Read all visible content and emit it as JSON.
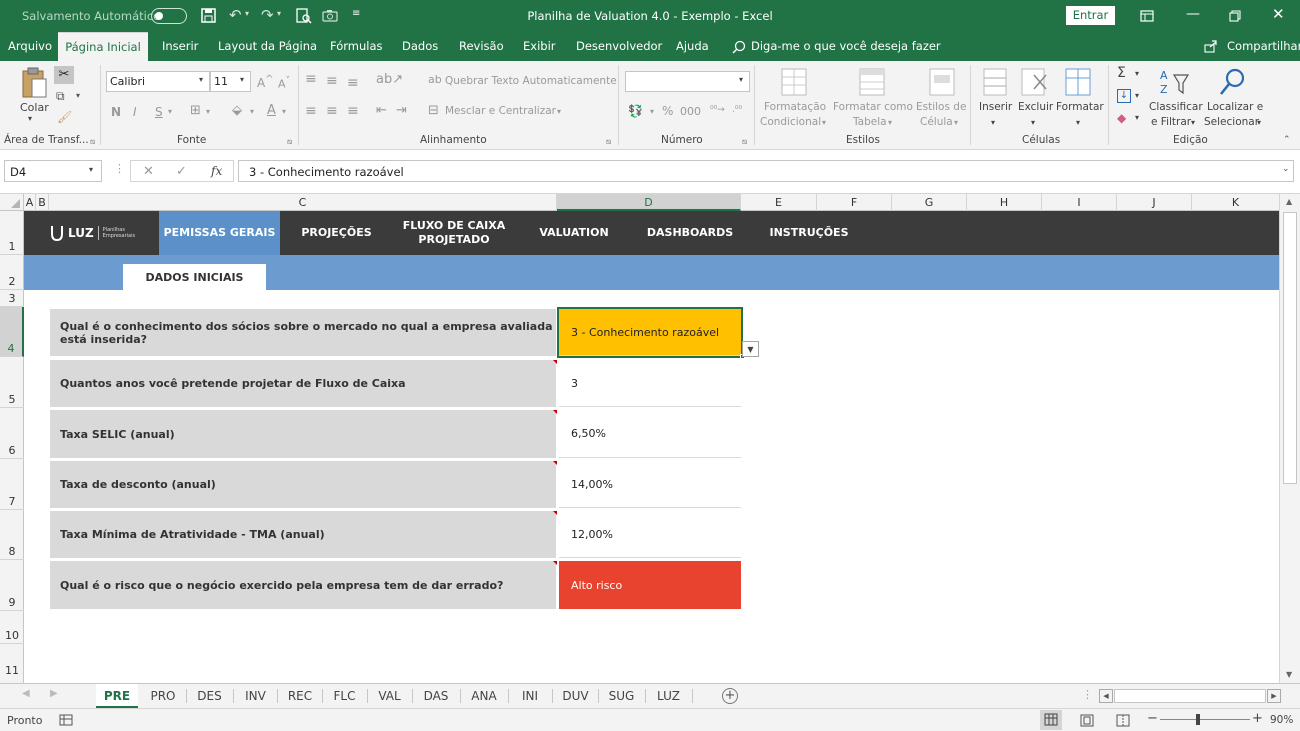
{
  "titlebar": {
    "autosave_label": "Salvamento Automático",
    "autosave_state": "Desativado",
    "title": "Planilha de Valuation 4.0 - Exemplo  -  Excel",
    "signin_label": "Entrar"
  },
  "tabs": [
    {
      "label": "Arquivo"
    },
    {
      "label": "Página Inicial"
    },
    {
      "label": "Inserir"
    },
    {
      "label": "Layout da Página"
    },
    {
      "label": "Fórmulas"
    },
    {
      "label": "Dados"
    },
    {
      "label": "Revisão"
    },
    {
      "label": "Exibir"
    },
    {
      "label": "Desenvolvedor"
    },
    {
      "label": "Ajuda"
    }
  ],
  "tellme": "Diga-me o que você deseja fazer",
  "share": "Compartilhar",
  "ribbon": {
    "paste": "Colar",
    "clipboard_group": "Área de Transf...",
    "font_name": "Calibri",
    "font_size": "11",
    "bold": "N",
    "italic": "I",
    "underline": "S",
    "font_group": "Fonte",
    "wrap_text": "Quebrar Texto Automaticamente",
    "merge_center": "Mesclar e Centralizar",
    "alignment_group": "Alinhamento",
    "number_format": "",
    "number_group": "Número",
    "cond_format_1": "Formatação",
    "cond_format_2": "Condicional",
    "format_table_1": "Formatar como",
    "format_table_2": "Tabela",
    "cell_styles_1": "Estilos de",
    "cell_styles_2": "Célula",
    "styles_group": "Estilos",
    "insert": "Inserir",
    "delete": "Excluir",
    "format": "Formatar",
    "cells_group": "Células",
    "sort_1": "Classificar",
    "sort_2": "e Filtrar",
    "find_1": "Localizar e",
    "find_2": "Selecionar",
    "editing_group": "Edição"
  },
  "formula_bar": {
    "name_box": "D4",
    "fx": "fx",
    "content": "3 - Conhecimento razoável"
  },
  "columns": [
    {
      "label": "A"
    },
    {
      "label": "B"
    },
    {
      "label": "C"
    },
    {
      "label": "D"
    },
    {
      "label": "E"
    },
    {
      "label": "F"
    },
    {
      "label": "G"
    },
    {
      "label": "H"
    },
    {
      "label": "I"
    },
    {
      "label": "J"
    },
    {
      "label": "K"
    }
  ],
  "rows": [
    {
      "label": "1"
    },
    {
      "label": "2"
    },
    {
      "label": "3"
    },
    {
      "label": "4"
    },
    {
      "label": "5"
    },
    {
      "label": "6"
    },
    {
      "label": "7"
    },
    {
      "label": "8"
    },
    {
      "label": "9"
    },
    {
      "label": "10"
    },
    {
      "label": "11"
    }
  ],
  "nav": {
    "logo_text": "LUZ",
    "logo_sub_1": "Planilhas",
    "logo_sub_2": "Empresariais",
    "items": [
      {
        "label": "PEMISSAS GERAIS"
      },
      {
        "label": "PROJEÇÕES"
      },
      {
        "label": "FLUXO DE CAIXA PROJETADO"
      },
      {
        "label": "VALUATION"
      },
      {
        "label": "DASHBOARDS"
      },
      {
        "label": "INSTRUÇÕES"
      }
    ]
  },
  "section_tab": "DADOS INICIAIS",
  "questions": [
    {
      "label": "Qual é o conhecimento dos sócios sobre o mercado no qual a empresa avaliada está inserida?",
      "value": "3 - Conhecimento razoável",
      "color": "#ffc000"
    },
    {
      "label": "Quantos anos você pretende projetar de Fluxo de Caixa",
      "value": "3",
      "color": "#ffffff"
    },
    {
      "label": "Taxa SELIC (anual)",
      "value": "6,50%",
      "color": "#ffffff"
    },
    {
      "label": "Taxa de desconto (anual)",
      "value": "14,00%",
      "color": "#ffffff"
    },
    {
      "label": "Taxa Mínima de Atratividade - TMA (anual)",
      "value": "12,00%",
      "color": "#ffffff"
    },
    {
      "label": "Qual é o risco que o negócio exercido pela empresa tem de dar errado?",
      "value": "Alto risco",
      "color": "#e8432e"
    }
  ],
  "sheets": [
    {
      "label": "PRE"
    },
    {
      "label": "PRO"
    },
    {
      "label": "DES"
    },
    {
      "label": "INV"
    },
    {
      "label": "REC"
    },
    {
      "label": "FLC"
    },
    {
      "label": "VAL"
    },
    {
      "label": "DAS"
    },
    {
      "label": "ANA"
    },
    {
      "label": "INI"
    },
    {
      "label": "DUV"
    },
    {
      "label": "SUG"
    },
    {
      "label": "LUZ"
    }
  ],
  "status": {
    "ready": "Pronto",
    "zoom": "90%"
  },
  "colors": {
    "excel_green": "#217346",
    "nav_dark": "#3b3b3b",
    "nav_active": "#5b91c8",
    "band_blue": "#6c9bd0",
    "label_gray": "#d9d9d9"
  }
}
